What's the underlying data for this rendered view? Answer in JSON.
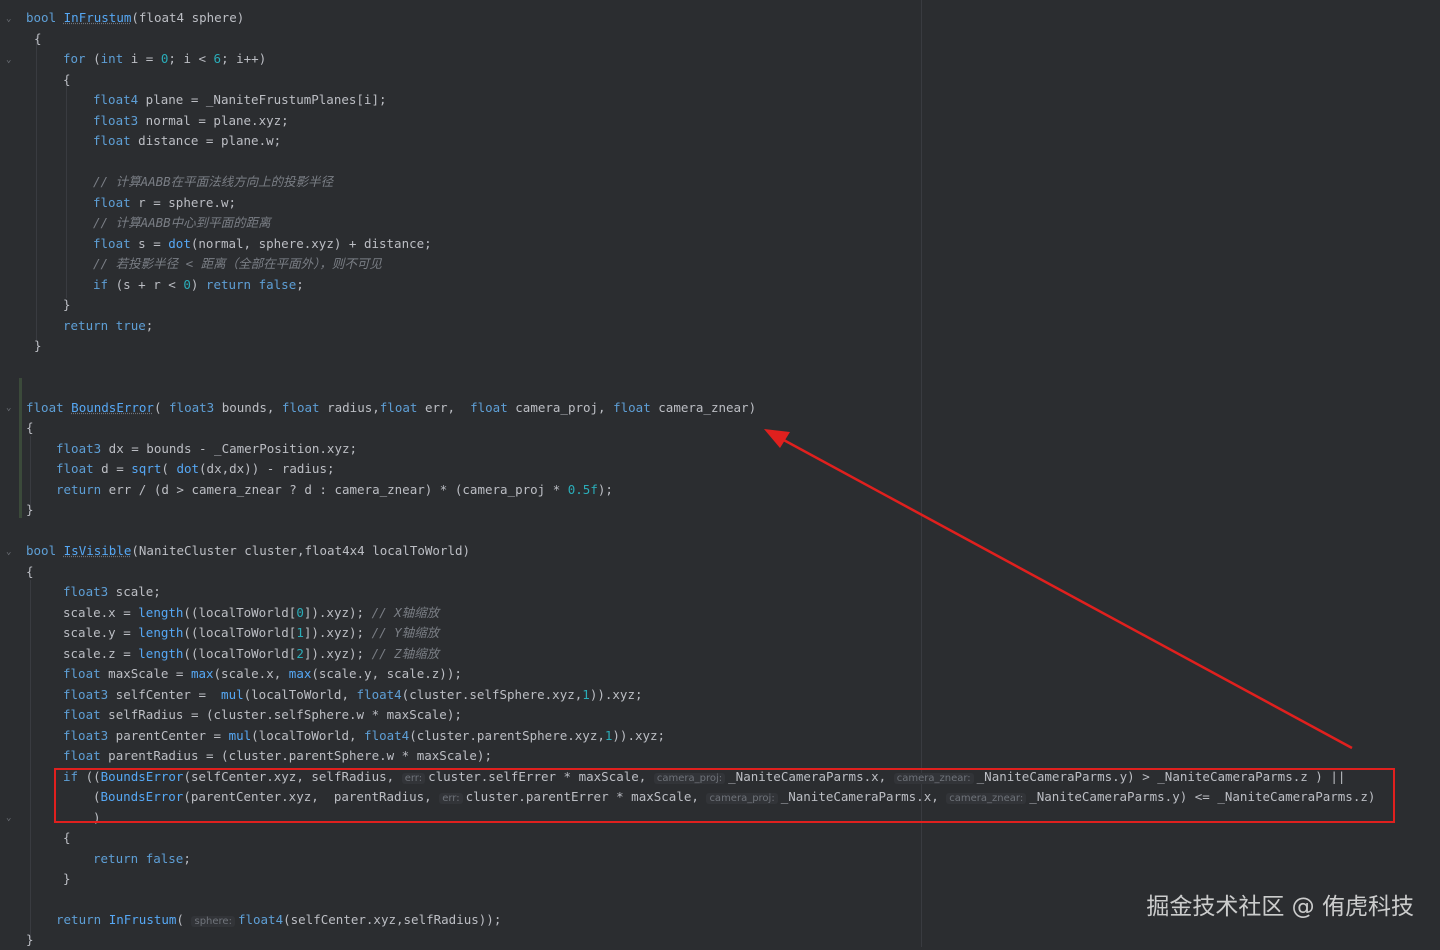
{
  "code": {
    "l1": {
      "kw": "bool",
      "fn": "InFrustum",
      "rest": "(float4 sphere)"
    },
    "l2": "{",
    "l3": {
      "kw": "for",
      "a": " (",
      "ty": "int",
      "b": " i = ",
      "n1": "0",
      "c": "; i < ",
      "n2": "6",
      "d": "; i++)"
    },
    "l4": "{",
    "l5": {
      "ty": "float4",
      "rest": " plane = _NaniteFrustumPlanes[i];"
    },
    "l6": {
      "ty": "float3",
      "rest": " normal = plane.xyz;"
    },
    "l7": {
      "ty": "float",
      "rest": " distance = plane.w;"
    },
    "l8": "// 计算AABB在平面法线方向上的投影半径",
    "l9": {
      "ty": "float",
      "rest": " r = sphere.w;"
    },
    "l10": "// 计算AABB中心到平面的距离",
    "l11": {
      "ty": "float",
      "a": " s = ",
      "fn": "dot",
      "b": "(normal, sphere.xyz) + distance;"
    },
    "l12": "// 若投影半径 < 距离（全部在平面外），则不可见",
    "l13": {
      "kw": "if",
      "a": " (s + r < ",
      "n": "0",
      "b": ") ",
      "kw2": "return",
      "kw3": "false",
      "c": ";"
    },
    "l14": "}",
    "l15": {
      "kw": "return",
      "kw2": "true",
      "c": ";"
    },
    "l16": "}",
    "l17": {
      "ty": "float",
      "fn": "BoundsError",
      "a": "( ",
      "t1": "float3",
      "b": " bounds, ",
      "t2": "float",
      "c": " radius,",
      "t3": "float",
      "d": " err,  ",
      "t4": "float",
      "e": " camera_proj, ",
      "t5": "float",
      "f": " camera_znear)"
    },
    "l18": "{",
    "l19": {
      "ty": "float3",
      "rest": " dx = bounds - _CamerPosition.xyz;"
    },
    "l20": {
      "ty": "float",
      "a": " d = ",
      "fn1": "sqrt",
      "b": "( ",
      "fn2": "dot",
      "c": "(dx,dx)) - radius;"
    },
    "l21": {
      "kw": "return",
      "a": " err / (d > camera_znear ? d : camera_znear) * (camera_proj * ",
      "n": "0.5f",
      "b": ");"
    },
    "l22": "}",
    "l23": {
      "kw": "bool",
      "fn": "IsVisible",
      "rest": "(NaniteCluster cluster,float4x4 localToWorld)"
    },
    "l24": "{",
    "l25": {
      "ty": "float3",
      "rest": " scale;"
    },
    "l26": {
      "a": "scale.x = ",
      "fn": "length",
      "b": "((localToWorld[",
      "n": "0",
      "c": "]).xyz); ",
      "cm": "// X轴缩放"
    },
    "l27": {
      "a": "scale.y = ",
      "fn": "length",
      "b": "((localToWorld[",
      "n": "1",
      "c": "]).xyz); ",
      "cm": "// Y轴缩放"
    },
    "l28": {
      "a": "scale.z = ",
      "fn": "length",
      "b": "((localToWorld[",
      "n": "2",
      "c": "]).xyz); ",
      "cm": "// Z轴缩放"
    },
    "l29": {
      "ty": "float",
      "a": " maxScale = ",
      "fn1": "max",
      "b": "(scale.x, ",
      "fn2": "max",
      "c": "(scale.y, scale.z));"
    },
    "l30": {
      "ty": "float3",
      "a": " selfCenter =  ",
      "fn": "mul",
      "b": "(localToWorld, ",
      "t2": "float4",
      "c": "(cluster.selfSphere.xyz,",
      "n": "1",
      "d": ")).xyz;"
    },
    "l31": {
      "ty": "float",
      "rest": " selfRadius = (cluster.selfSphere.w * maxScale);"
    },
    "l32": {
      "ty": "float3",
      "a": " parentCenter = ",
      "fn": "mul",
      "b": "(localToWorld, ",
      "t2": "float4",
      "c": "(cluster.parentSphere.xyz,",
      "n": "1",
      "d": ")).xyz;"
    },
    "l33": {
      "ty": "float",
      "rest": " parentRadius = (cluster.parentSphere.w * maxScale);"
    },
    "l34": {
      "kw": "if",
      "a": " ((",
      "fn": "BoundsError",
      "b": "(selfCenter.xyz, selfRadius, ",
      "h1": "err:",
      "c": "cluster.selfErrer * maxScale, ",
      "h2": "camera_proj:",
      "d": "_NaniteCameraParms.x, ",
      "h3": "camera_znear:",
      "e": "_NaniteCameraParms.y) > _NaniteCameraParms.z ) ||"
    },
    "l35": {
      "a": "(",
      "fn": "BoundsError",
      "b": "(parentCenter.xyz,  parentRadius, ",
      "h1": "err:",
      "c": "cluster.parentErrer * maxScale, ",
      "h2": "camera_proj:",
      "d": "_NaniteCameraParms.x, ",
      "h3": "camera_znear:",
      "e": "_NaniteCameraParms.y) <= _NaniteCameraParms.z)"
    },
    "l36": ")",
    "l37": "{",
    "l38": {
      "kw": "return",
      "kw2": "false",
      "c": ";"
    },
    "l39": "}",
    "l40": {
      "kw": "return",
      "fn": "InFrustum",
      "a": "( ",
      "h": "sphere:",
      "t": "float4",
      "b": "(selfCenter.xyz,selfRadius));"
    },
    "l41": "}"
  },
  "watermark": "掘金技术社区 @ 侑虎科技",
  "colors": {
    "highlight_box": "#e0201e",
    "arrow": "#e0201e"
  }
}
